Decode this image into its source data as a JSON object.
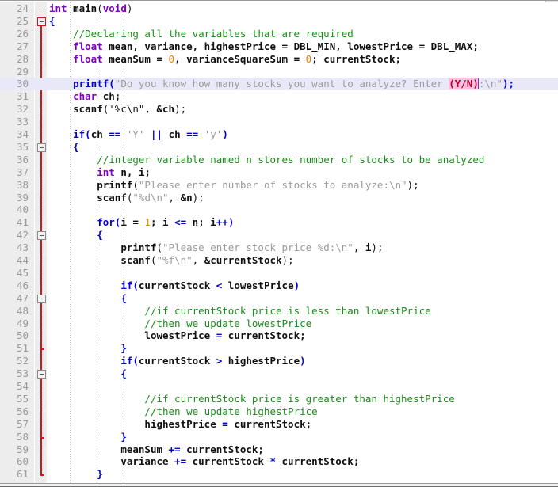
{
  "app": {
    "kind": "code-editor",
    "language": "C",
    "theme": "light"
  },
  "colors": {
    "background": "#ffffff",
    "gutter_background": "#ededed",
    "line_number": "#9a9a9a",
    "current_line_highlight": "#e8e8f8",
    "keyword": "#8000c0",
    "function": "#0000d0",
    "comment": "#1a8c1a",
    "string": "#9b9b9b",
    "number": "#e88000",
    "plain_text": "#101010",
    "fold_rail": "#d01818",
    "search_match_background": "#ffc0e0",
    "search_match_text": "#b00030",
    "caret": "#6a3ad0",
    "indent_guide": "#b9b9b9"
  },
  "editor": {
    "first_visible_line": 24,
    "last_visible_line": 61,
    "caret_line": 30,
    "current_line": 30,
    "search_match_text": "(Y/N)"
  },
  "fold_markers": [
    {
      "line": 25,
      "state": "expanded",
      "glyph": "minus",
      "active": true
    },
    {
      "line": 35,
      "state": "expanded",
      "glyph": "minus",
      "active": false
    },
    {
      "line": 42,
      "state": "expanded",
      "glyph": "minus",
      "active": false
    },
    {
      "line": 47,
      "state": "expanded",
      "glyph": "minus",
      "active": false
    },
    {
      "line": 53,
      "state": "expanded",
      "glyph": "minus",
      "active": false
    }
  ],
  "fold_end_ticks": [
    51,
    58,
    61
  ],
  "lines": [
    {
      "n": 24,
      "text": "int main(void)",
      "tokens": [
        {
          "t": "int",
          "c": "t-kw"
        },
        {
          "t": " ",
          "c": "t-plain"
        },
        {
          "t": "main",
          "c": "t-b"
        },
        {
          "t": "(",
          "c": "t-punct"
        },
        {
          "t": "void",
          "c": "t-kw"
        },
        {
          "t": ")",
          "c": "t-punct"
        }
      ]
    },
    {
      "n": 25,
      "text": "{",
      "tokens": [
        {
          "t": "{",
          "c": "t-brace"
        }
      ]
    },
    {
      "n": 26,
      "text": "    //Declaring all the variables that are required",
      "tokens": [
        {
          "t": "    ",
          "c": "t-plain"
        },
        {
          "t": "//Declaring all the variables that are required",
          "c": "t-cmt"
        }
      ]
    },
    {
      "n": 27,
      "text": "    float mean, variance, highestPrice = DBL_MIN, lowestPrice = DBL_MAX;",
      "tokens": [
        {
          "t": "    ",
          "c": "t-plain"
        },
        {
          "t": "float",
          "c": "t-kw"
        },
        {
          "t": " mean, variance, highestPrice = DBL_MIN, lowestPrice = DBL_MAX;",
          "c": "t-b"
        }
      ]
    },
    {
      "n": 28,
      "text": "    float meanSum = 0, varianceSquareSum = 0; currentStock;",
      "tokens": [
        {
          "t": "    ",
          "c": "t-plain"
        },
        {
          "t": "float",
          "c": "t-kw"
        },
        {
          "t": " meanSum = ",
          "c": "t-b"
        },
        {
          "t": "0",
          "c": "t-num"
        },
        {
          "t": ", varianceSquareSum = ",
          "c": "t-b"
        },
        {
          "t": "0",
          "c": "t-num"
        },
        {
          "t": "; currentStock;",
          "c": "t-b"
        }
      ]
    },
    {
      "n": 29,
      "text": "",
      "tokens": []
    },
    {
      "n": 30,
      "text": "    printf(\"Do you know how many stocks you want to analyze? Enter (Y/N):\\n\");",
      "current": true,
      "tokens": [
        {
          "t": "    ",
          "c": "t-plain"
        },
        {
          "t": "printf",
          "c": "t-fn"
        },
        {
          "t": "(",
          "c": "t-op"
        },
        {
          "t": "\"Do you know how many stocks you want to analyze? Enter ",
          "c": "t-str"
        },
        {
          "t": "(Y/N)",
          "c": "t-match"
        },
        {
          "t": "CARET",
          "c": "caret"
        },
        {
          "t": ":\\n\"",
          "c": "t-str"
        },
        {
          "t": ")",
          "c": "t-op"
        },
        {
          "t": ";",
          "c": "t-op"
        }
      ]
    },
    {
      "n": 31,
      "text": "    char ch;",
      "tokens": [
        {
          "t": "    ",
          "c": "t-plain"
        },
        {
          "t": "char",
          "c": "t-kw"
        },
        {
          "t": " ch;",
          "c": "t-b"
        }
      ]
    },
    {
      "n": 32,
      "text": "    scanf('%c\\n\", &ch);",
      "tokens": [
        {
          "t": "    ",
          "c": "t-plain"
        },
        {
          "t": "scanf",
          "c": "t-b"
        },
        {
          "t": "(",
          "c": "t-punct"
        },
        {
          "t": "'%c\\n\"",
          "c": "t-plain"
        },
        {
          "t": ", ",
          "c": "t-punct"
        },
        {
          "t": "&ch",
          "c": "t-b"
        },
        {
          "t": ");",
          "c": "t-punct"
        }
      ]
    },
    {
      "n": 33,
      "text": "",
      "tokens": []
    },
    {
      "n": 34,
      "text": "    if(ch == 'Y' || ch == 'y')",
      "tokens": [
        {
          "t": "    ",
          "c": "t-plain"
        },
        {
          "t": "if",
          "c": "t-fn"
        },
        {
          "t": "(",
          "c": "t-op"
        },
        {
          "t": "ch ",
          "c": "t-b"
        },
        {
          "t": "==",
          "c": "t-op"
        },
        {
          "t": " ",
          "c": "t-plain"
        },
        {
          "t": "'Y'",
          "c": "t-str"
        },
        {
          "t": " ",
          "c": "t-plain"
        },
        {
          "t": "||",
          "c": "t-op"
        },
        {
          "t": " ch ",
          "c": "t-b"
        },
        {
          "t": "==",
          "c": "t-op"
        },
        {
          "t": " ",
          "c": "t-plain"
        },
        {
          "t": "'y'",
          "c": "t-str"
        },
        {
          "t": ")",
          "c": "t-op"
        }
      ]
    },
    {
      "n": 35,
      "text": "    {",
      "tokens": [
        {
          "t": "    ",
          "c": "t-plain"
        },
        {
          "t": "{",
          "c": "t-brace"
        }
      ]
    },
    {
      "n": 36,
      "text": "        //integer variable named n stores number of stocks to be analyzed",
      "tokens": [
        {
          "t": "        ",
          "c": "t-plain"
        },
        {
          "t": "//integer variable named n stores number of stocks to be analyzed",
          "c": "t-cmt"
        }
      ]
    },
    {
      "n": 37,
      "text": "        int n, i;",
      "tokens": [
        {
          "t": "        ",
          "c": "t-plain"
        },
        {
          "t": "int",
          "c": "t-kw"
        },
        {
          "t": " n, i;",
          "c": "t-b"
        }
      ]
    },
    {
      "n": 38,
      "text": "        printf(\"Please enter number of stocks to analyze:\\n\");",
      "tokens": [
        {
          "t": "        ",
          "c": "t-plain"
        },
        {
          "t": "printf",
          "c": "t-b"
        },
        {
          "t": "(",
          "c": "t-punct"
        },
        {
          "t": "\"Please enter number of stocks to analyze:\\n\"",
          "c": "t-str"
        },
        {
          "t": ");",
          "c": "t-punct"
        }
      ]
    },
    {
      "n": 39,
      "text": "        scanf(\"%d\\n\", &n);",
      "tokens": [
        {
          "t": "        ",
          "c": "t-plain"
        },
        {
          "t": "scanf",
          "c": "t-b"
        },
        {
          "t": "(",
          "c": "t-punct"
        },
        {
          "t": "\"%d\\n\"",
          "c": "t-str"
        },
        {
          "t": ", ",
          "c": "t-punct"
        },
        {
          "t": "&n",
          "c": "t-b"
        },
        {
          "t": ");",
          "c": "t-punct"
        }
      ]
    },
    {
      "n": 40,
      "text": "",
      "tokens": []
    },
    {
      "n": 41,
      "text": "        for(i = 1; i <= n; i++)",
      "tokens": [
        {
          "t": "        ",
          "c": "t-plain"
        },
        {
          "t": "for",
          "c": "t-fn"
        },
        {
          "t": "(",
          "c": "t-op"
        },
        {
          "t": "i = ",
          "c": "t-b"
        },
        {
          "t": "1",
          "c": "t-num"
        },
        {
          "t": "; i ",
          "c": "t-b"
        },
        {
          "t": "<=",
          "c": "t-op"
        },
        {
          "t": " n; i",
          "c": "t-b"
        },
        {
          "t": "++",
          "c": "t-op"
        },
        {
          "t": ")",
          "c": "t-op"
        }
      ]
    },
    {
      "n": 42,
      "text": "        {",
      "tokens": [
        {
          "t": "        ",
          "c": "t-plain"
        },
        {
          "t": "{",
          "c": "t-brace"
        }
      ]
    },
    {
      "n": 43,
      "text": "            printf(\"Please enter stock price %d:\\n\", i);",
      "tokens": [
        {
          "t": "            ",
          "c": "t-plain"
        },
        {
          "t": "printf",
          "c": "t-b"
        },
        {
          "t": "(",
          "c": "t-punct"
        },
        {
          "t": "\"Please enter stock price %d:\\n\"",
          "c": "t-str"
        },
        {
          "t": ", ",
          "c": "t-punct"
        },
        {
          "t": "i",
          "c": "t-b"
        },
        {
          "t": ");",
          "c": "t-punct"
        }
      ]
    },
    {
      "n": 44,
      "text": "            scanf(\"%f\\n\", &currentStock);",
      "tokens": [
        {
          "t": "            ",
          "c": "t-plain"
        },
        {
          "t": "scanf",
          "c": "t-b"
        },
        {
          "t": "(",
          "c": "t-punct"
        },
        {
          "t": "\"%f\\n\"",
          "c": "t-str"
        },
        {
          "t": ", ",
          "c": "t-punct"
        },
        {
          "t": "&currentStock",
          "c": "t-b"
        },
        {
          "t": ");",
          "c": "t-punct"
        }
      ]
    },
    {
      "n": 45,
      "text": "",
      "tokens": []
    },
    {
      "n": 46,
      "text": "            if(currentStock < lowestPrice)",
      "tokens": [
        {
          "t": "            ",
          "c": "t-plain"
        },
        {
          "t": "if",
          "c": "t-fn"
        },
        {
          "t": "(",
          "c": "t-op"
        },
        {
          "t": "currentStock ",
          "c": "t-b"
        },
        {
          "t": "<",
          "c": "t-op"
        },
        {
          "t": " lowestPrice",
          "c": "t-b"
        },
        {
          "t": ")",
          "c": "t-op"
        }
      ]
    },
    {
      "n": 47,
      "text": "            {",
      "tokens": [
        {
          "t": "            ",
          "c": "t-plain"
        },
        {
          "t": "{",
          "c": "t-brace"
        }
      ]
    },
    {
      "n": 48,
      "text": "                //if currentStock price is less than lowestPrice",
      "tokens": [
        {
          "t": "                ",
          "c": "t-plain"
        },
        {
          "t": "//if currentStock price is less than lowestPrice",
          "c": "t-cmt"
        }
      ]
    },
    {
      "n": 49,
      "text": "                //then we update lowestPrice",
      "tokens": [
        {
          "t": "                ",
          "c": "t-plain"
        },
        {
          "t": "//then we update lowestPrice",
          "c": "t-cmt"
        }
      ]
    },
    {
      "n": 50,
      "text": "                lowestPrice = currentStock;",
      "tokens": [
        {
          "t": "                ",
          "c": "t-plain"
        },
        {
          "t": "lowestPrice ",
          "c": "t-b"
        },
        {
          "t": "=",
          "c": "t-op"
        },
        {
          "t": " currentStock;",
          "c": "t-b"
        }
      ]
    },
    {
      "n": 51,
      "text": "            }",
      "tokens": [
        {
          "t": "            ",
          "c": "t-plain"
        },
        {
          "t": "}",
          "c": "t-brace"
        }
      ]
    },
    {
      "n": 52,
      "text": "            if(currentStock > highestPrice)",
      "tokens": [
        {
          "t": "            ",
          "c": "t-plain"
        },
        {
          "t": "if",
          "c": "t-fn"
        },
        {
          "t": "(",
          "c": "t-op"
        },
        {
          "t": "currentStock ",
          "c": "t-b"
        },
        {
          "t": ">",
          "c": "t-op"
        },
        {
          "t": " highestPrice",
          "c": "t-b"
        },
        {
          "t": ")",
          "c": "t-op"
        }
      ]
    },
    {
      "n": 53,
      "text": "            {",
      "tokens": [
        {
          "t": "            ",
          "c": "t-plain"
        },
        {
          "t": "{",
          "c": "t-brace"
        }
      ]
    },
    {
      "n": 54,
      "text": "",
      "tokens": []
    },
    {
      "n": 55,
      "text": "                //if currentStock price is greater than highestPrice",
      "tokens": [
        {
          "t": "                ",
          "c": "t-plain"
        },
        {
          "t": "//if currentStock price is greater than highestPrice",
          "c": "t-cmt"
        }
      ]
    },
    {
      "n": 56,
      "text": "                //then we update highestPrice",
      "tokens": [
        {
          "t": "                ",
          "c": "t-plain"
        },
        {
          "t": "//then we update highestPrice",
          "c": "t-cmt"
        }
      ]
    },
    {
      "n": 57,
      "text": "                highestPrice = currentStock;",
      "tokens": [
        {
          "t": "                ",
          "c": "t-plain"
        },
        {
          "t": "highestPrice ",
          "c": "t-b"
        },
        {
          "t": "=",
          "c": "t-op"
        },
        {
          "t": " currentStock;",
          "c": "t-b"
        }
      ]
    },
    {
      "n": 58,
      "text": "            }",
      "tokens": [
        {
          "t": "            ",
          "c": "t-plain"
        },
        {
          "t": "}",
          "c": "t-brace"
        }
      ]
    },
    {
      "n": 59,
      "text": "            meanSum += currentStock;",
      "tokens": [
        {
          "t": "            ",
          "c": "t-plain"
        },
        {
          "t": "meanSum ",
          "c": "t-b"
        },
        {
          "t": "+=",
          "c": "t-op"
        },
        {
          "t": " currentStock;",
          "c": "t-b"
        }
      ]
    },
    {
      "n": 60,
      "text": "            variance += currentStock * currentStock;",
      "tokens": [
        {
          "t": "            ",
          "c": "t-plain"
        },
        {
          "t": "variance ",
          "c": "t-b"
        },
        {
          "t": "+=",
          "c": "t-op"
        },
        {
          "t": " currentStock ",
          "c": "t-b"
        },
        {
          "t": "*",
          "c": "t-op"
        },
        {
          "t": " currentStock;",
          "c": "t-b"
        }
      ]
    },
    {
      "n": 61,
      "text": "        }",
      "tokens": [
        {
          "t": "        ",
          "c": "t-plain"
        },
        {
          "t": "}",
          "c": "t-brace"
        }
      ]
    }
  ]
}
